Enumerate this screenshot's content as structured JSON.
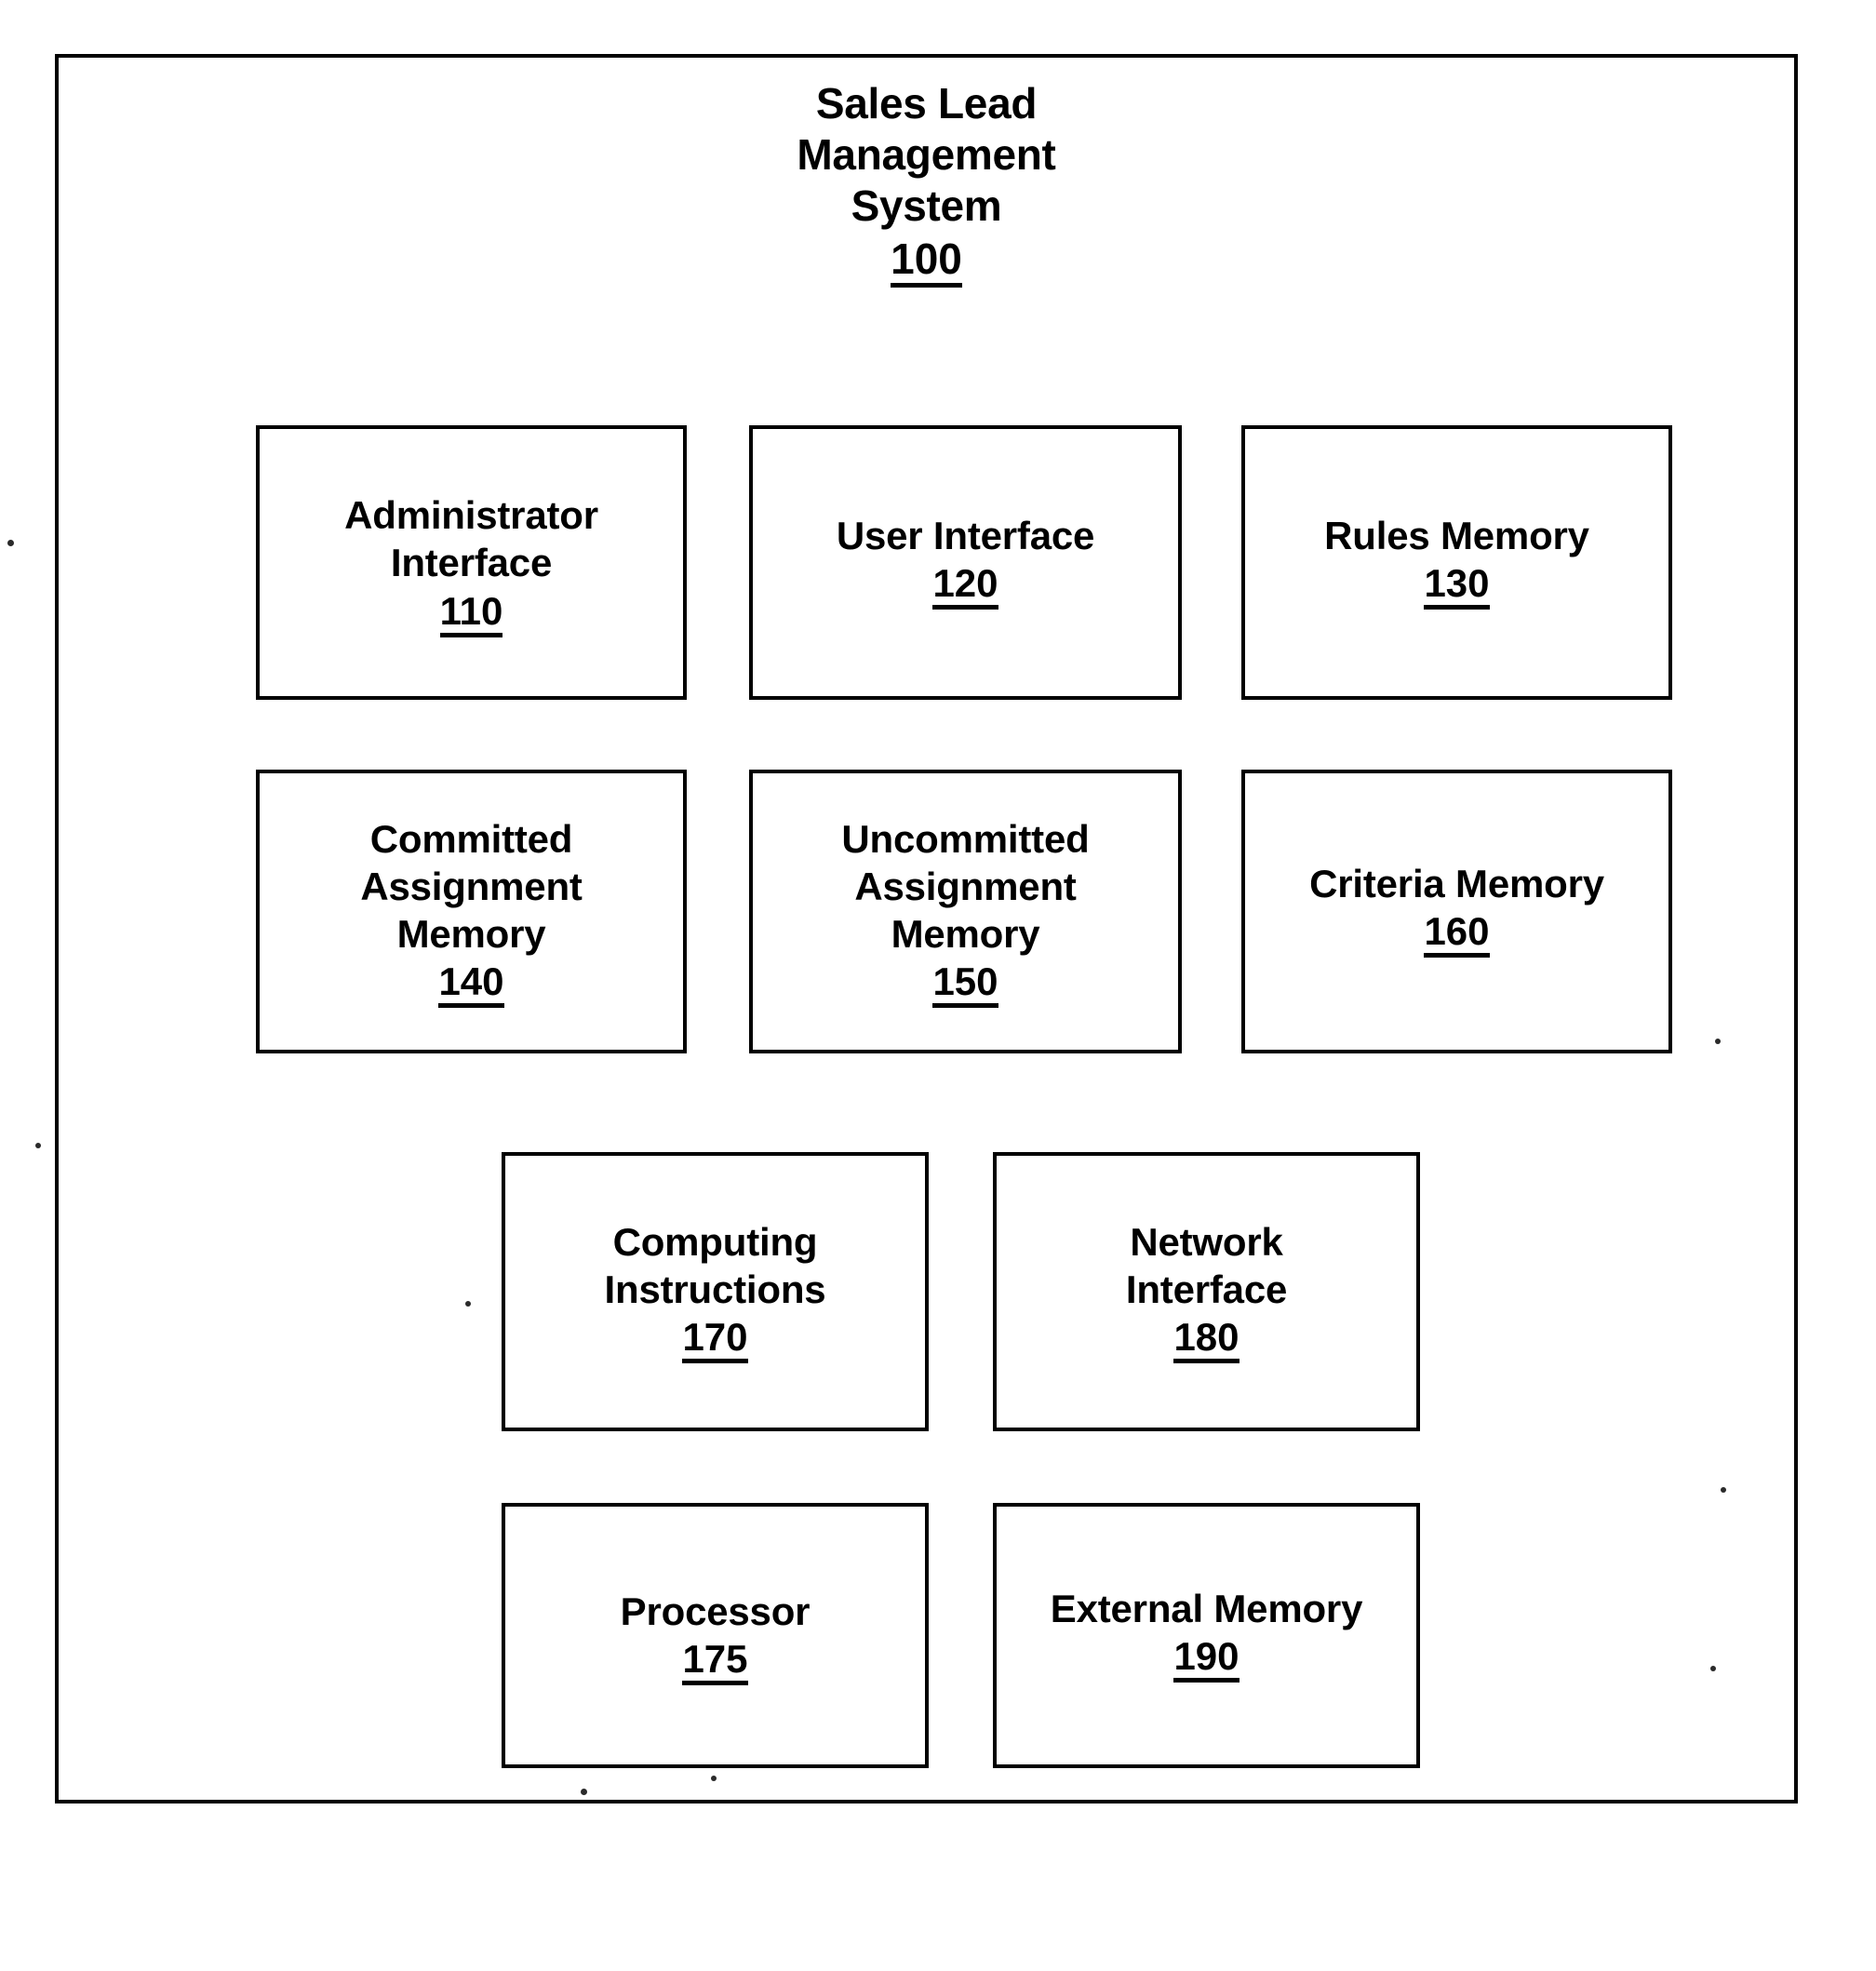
{
  "figure": {
    "system": {
      "title_lines": [
        "Sales Lead",
        "Management",
        "System"
      ],
      "title_line_1": "Sales Lead",
      "title_line_2": "Management",
      "title_line_3": "System",
      "reference_numeral": "100"
    },
    "components": [
      {
        "id": "admin-interface",
        "label": "Administrator\nInterface",
        "reference_numeral": "110"
      },
      {
        "id": "user-interface",
        "label": "User Interface",
        "reference_numeral": "120"
      },
      {
        "id": "rules-memory",
        "label": "Rules Memory",
        "reference_numeral": "130"
      },
      {
        "id": "committed-memory",
        "label": "Committed\nAssignment\nMemory",
        "reference_numeral": "140"
      },
      {
        "id": "uncommitted-memory",
        "label": "Uncommitted\nAssignment\nMemory",
        "reference_numeral": "150"
      },
      {
        "id": "criteria-memory",
        "label": "Criteria Memory",
        "reference_numeral": "160"
      },
      {
        "id": "computing-instructions",
        "label": "Computing\nInstructions",
        "reference_numeral": "170"
      },
      {
        "id": "network-interface",
        "label": "Network\nInterface",
        "reference_numeral": "180"
      },
      {
        "id": "processor",
        "label": "Processor",
        "reference_numeral": "175"
      },
      {
        "id": "external-memory",
        "label": "External Memory",
        "reference_numeral": "190"
      }
    ],
    "colors": {
      "ink": "#000000",
      "paper": "#ffffff"
    }
  }
}
